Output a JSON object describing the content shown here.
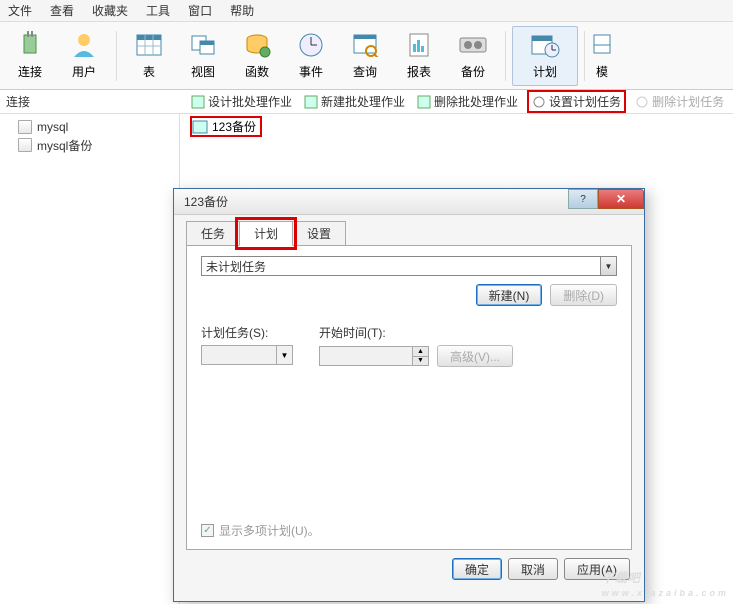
{
  "menu": {
    "file": "文件",
    "view": "查看",
    "favorites": "收藏夹",
    "tools": "工具",
    "window": "窗口",
    "help": "帮助"
  },
  "toolbar": {
    "connect": "连接",
    "user": "用户",
    "table": "表",
    "view": "视图",
    "function": "函数",
    "event": "事件",
    "query": "查询",
    "report": "报表",
    "backup": "备份",
    "schedule": "计划",
    "model": "模"
  },
  "subbar": {
    "left": "连接",
    "design": "设计批处理作业",
    "new": "新建批处理作业",
    "delete": "删除批处理作业",
    "setSchedule": "设置计划任务",
    "delSchedule": "删除计划任务"
  },
  "sidebar": {
    "items": [
      "mysql",
      "mysql备份"
    ]
  },
  "backupLink": "123备份",
  "dialog": {
    "title": "123备份",
    "tabs": {
      "task": "任务",
      "plan": "计划",
      "settings": "设置"
    },
    "comboValue": "未计划任务",
    "newBtn": "新建(N)",
    "delBtn": "删除(D)",
    "planLabel": "计划任务(S):",
    "startLabel": "开始时间(T):",
    "advBtn": "高级(V)...",
    "showMulti": "显示多项计划(U)。",
    "ok": "确定",
    "cancel": "取消",
    "apply": "应用(A)"
  },
  "watermark": {
    "big": "下载吧",
    "small": "www.xiazaiba.com"
  }
}
